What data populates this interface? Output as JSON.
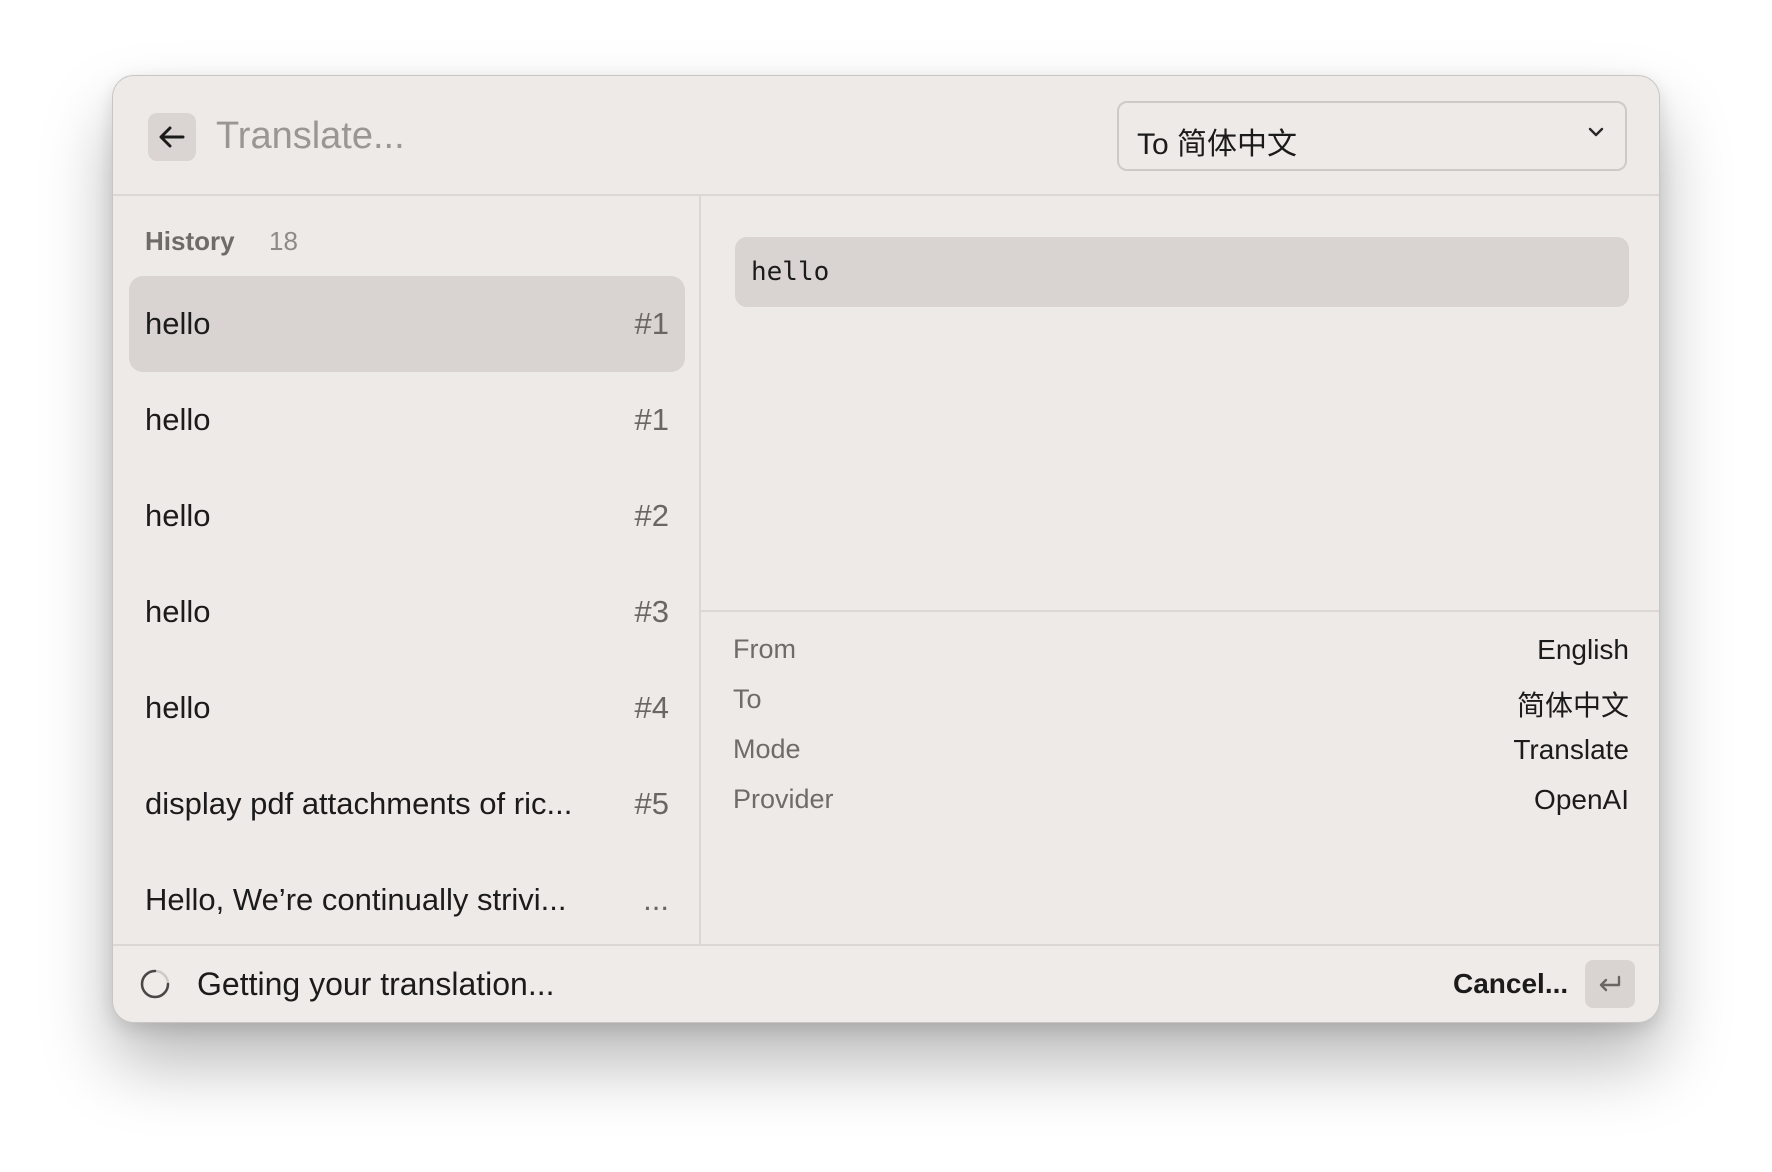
{
  "header": {
    "search_placeholder": "Translate...",
    "target_language_label": "To 简体中文"
  },
  "history": {
    "title": "History",
    "count": "18",
    "items": [
      {
        "label": "hello",
        "index": "#1",
        "selected": true
      },
      {
        "label": "hello",
        "index": "#1"
      },
      {
        "label": "hello",
        "index": "#2"
      },
      {
        "label": "hello",
        "index": "#3"
      },
      {
        "label": "hello",
        "index": "#4"
      },
      {
        "label": "display pdf attachments of ric...",
        "index": "#5"
      },
      {
        "label": "Hello,  We’re continually strivi...",
        "index": "..."
      }
    ]
  },
  "detail": {
    "input_text": "hello",
    "metadata": [
      {
        "key": "From",
        "value": "English"
      },
      {
        "key": "To",
        "value": "简体中文"
      },
      {
        "key": "Mode",
        "value": "Translate"
      },
      {
        "key": "Provider",
        "value": "OpenAI"
      }
    ]
  },
  "footer": {
    "status": "Getting your translation...",
    "cancel_label": "Cancel...",
    "enter_key_icon": "return-key-icon"
  },
  "colors": {
    "window_bg": "#eeeae7",
    "selected_bg": "#d9d4d1",
    "divider": "#dcd7d4",
    "text_primary": "#1c1b1b",
    "text_secondary": "#6f6b69"
  }
}
